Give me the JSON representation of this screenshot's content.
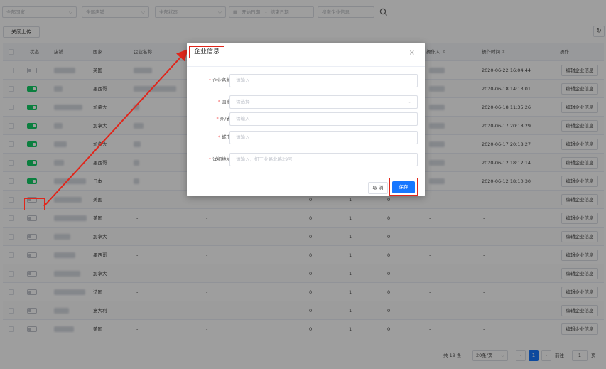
{
  "filters": {
    "country": "全部国家",
    "shop": "全部店铺",
    "status": "全部状态",
    "start_date": "开始日期",
    "date_sep": "-",
    "end_date": "结束日期",
    "company_search": "搜索企业信息"
  },
  "toolbar": {
    "close_upload": "关闭上传",
    "refresh_icon": "↻"
  },
  "table": {
    "headers": {
      "status": "状态",
      "shop": "店铺",
      "country": "国家",
      "company": "企业名称",
      "operator": "操作人 ⇕",
      "op_time": "操作时间 ⇕",
      "action": "操作"
    },
    "action_label": "编辑企业信息",
    "rows": [
      {
        "on": false,
        "country": "英国",
        "c1": "",
        "c2": "",
        "c3": "",
        "op_time": "2020-06-22 16:04:44"
      },
      {
        "on": true,
        "country": "墨西哥",
        "c1": "",
        "c2": "",
        "c3": "",
        "op_time": "2020-06-18 14:13:01"
      },
      {
        "on": true,
        "country": "加拿大",
        "c1": "",
        "c2": "",
        "c3": "",
        "op_time": "2020-06-18 11:35:26"
      },
      {
        "on": true,
        "country": "加拿大",
        "c1": "",
        "c2": "",
        "c3": "",
        "op_time": "2020-06-17 20:18:29"
      },
      {
        "on": true,
        "country": "加拿大",
        "c1": "",
        "c2": "",
        "c3": "",
        "op_time": "2020-06-17 20:18:27"
      },
      {
        "on": true,
        "country": "墨西哥",
        "c1": "",
        "c2": "",
        "c3": "",
        "op_time": "2020-06-12 18:12:14"
      },
      {
        "on": true,
        "country": "日本",
        "c1": "",
        "c2": "",
        "c3": "",
        "op_time": "2020-06-12 18:10:30"
      },
      {
        "on": false,
        "country": "美国",
        "company": "-",
        "c0": "-",
        "c1": "0",
        "c2": "1",
        "c3": "0",
        "operator": "-",
        "op_time": "-"
      },
      {
        "on": false,
        "country": "美国",
        "company": "-",
        "c0": "-",
        "c1": "0",
        "c2": "1",
        "c3": "0",
        "operator": "-",
        "op_time": "-"
      },
      {
        "on": false,
        "country": "加拿大",
        "company": "-",
        "c0": "-",
        "c1": "0",
        "c2": "1",
        "c3": "0",
        "operator": "-",
        "op_time": "-"
      },
      {
        "on": false,
        "country": "墨西哥",
        "company": "-",
        "c0": "-",
        "c1": "0",
        "c2": "1",
        "c3": "0",
        "operator": "-",
        "op_time": "-"
      },
      {
        "on": false,
        "country": "加拿大",
        "company": "-",
        "c0": "-",
        "c1": "0",
        "c2": "1",
        "c3": "0",
        "operator": "-",
        "op_time": "-"
      },
      {
        "on": false,
        "country": "法国",
        "company": "-",
        "c0": "-",
        "c1": "0",
        "c2": "1",
        "c3": "0",
        "operator": "-",
        "op_time": "-"
      },
      {
        "on": false,
        "country": "意大利",
        "company": "-",
        "c0": "-",
        "c1": "0",
        "c2": "1",
        "c3": "0",
        "operator": "-",
        "op_time": "-"
      },
      {
        "on": false,
        "country": "美国",
        "company": "-",
        "c0": "-",
        "c1": "0",
        "c2": "1",
        "c3": "0",
        "operator": "-",
        "op_time": "-"
      }
    ]
  },
  "pagination": {
    "total": "共 19 条",
    "page_size": "20条/页",
    "current": "1",
    "goto_label": "前往",
    "goto_value": "1",
    "unit": "页"
  },
  "modal": {
    "title": "企业信息",
    "close": "×",
    "fields": [
      {
        "label": "企业名称",
        "placeholder": "请输入",
        "select": false
      },
      {
        "label": "国家",
        "placeholder": "请选择",
        "select": true
      },
      {
        "label": "州/省",
        "placeholder": "请输入",
        "select": false
      },
      {
        "label": "城市",
        "placeholder": "请输入",
        "select": false
      },
      {
        "label": "详细地址",
        "placeholder": "请输入，如工业路北路29号",
        "select": false
      }
    ],
    "cancel": "取 消",
    "save": "保存"
  },
  "colors": {
    "primary": "#1677ff",
    "switch_on": "#13ce66",
    "annotation": "#e0261b"
  }
}
